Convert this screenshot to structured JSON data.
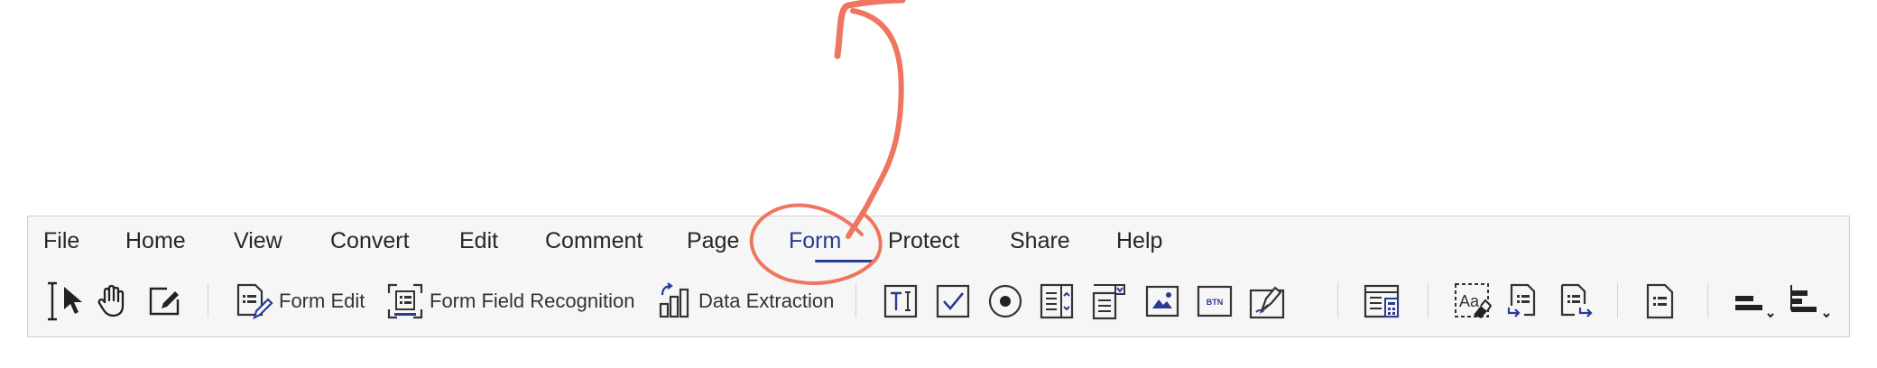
{
  "menu": {
    "items": [
      {
        "label": "File"
      },
      {
        "label": "Home"
      },
      {
        "label": "View"
      },
      {
        "label": "Convert"
      },
      {
        "label": "Edit"
      },
      {
        "label": "Comment"
      },
      {
        "label": "Page"
      },
      {
        "label": "Form"
      },
      {
        "label": "Protect"
      },
      {
        "label": "Share"
      },
      {
        "label": "Help"
      }
    ],
    "active": "Form"
  },
  "toolbar": {
    "form_edit_label": "Form Edit",
    "form_field_recognition_label": "Form Field Recognition",
    "data_extraction_label": "Data Extraction",
    "button_field_text": "BTN"
  },
  "icons": [
    "text-select-icon",
    "select-arrow-icon",
    "hand-icon",
    "edit-object-icon",
    "form-edit-icon",
    "form-field-recognition-icon",
    "data-extraction-icon",
    "text-field-icon",
    "checkbox-icon",
    "radio-button-icon",
    "list-box-icon",
    "combo-box-icon",
    "image-field-icon",
    "button-field-icon",
    "signature-field-icon",
    "calculate-icon",
    "clear-form-icon",
    "import-form-data-icon",
    "export-form-data-icon",
    "document-properties-icon",
    "align-left-icon",
    "align-distribute-icon"
  ],
  "colors": {
    "accent": "#2b3a92",
    "annotation": "#ee7660",
    "toolbar_bg": "#f6f6f6",
    "border": "#cfcfcf"
  }
}
